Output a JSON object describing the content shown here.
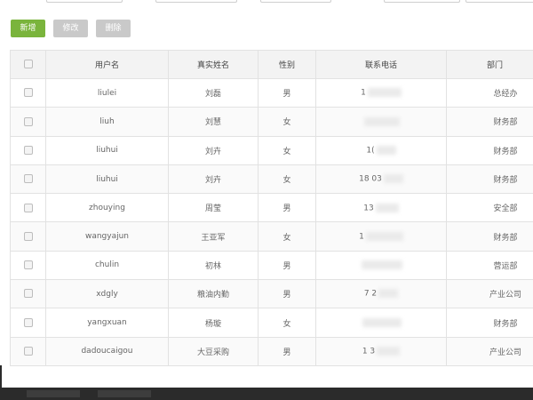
{
  "toolbar": {
    "add_label": "新增",
    "edit_label": "修改",
    "delete_label": "删除"
  },
  "colors": {
    "add_button": "#7ab43c",
    "disabled_button": "#c9c9c9"
  },
  "table": {
    "columns": [
      "",
      "用户名",
      "真实姓名",
      "性别",
      "联系电话",
      "部门"
    ],
    "rows": [
      {
        "username": "liulei",
        "realname": "刘磊",
        "gender": "男",
        "phone": "1",
        "dept": "总经办"
      },
      {
        "username": "liuh",
        "realname": "刘慧",
        "gender": "女",
        "phone": "",
        "dept": "财务部"
      },
      {
        "username": "liuhui",
        "realname": "刘卉",
        "gender": "女",
        "phone": "1(",
        "dept": "财务部"
      },
      {
        "username": "liuhui",
        "realname": "刘卉",
        "gender": "女",
        "phone": "18 03",
        "dept": "财务部"
      },
      {
        "username": "zhouying",
        "realname": "周莹",
        "gender": "男",
        "phone": "13",
        "dept": "安全部"
      },
      {
        "username": "wangyajun",
        "realname": "王亚军",
        "gender": "女",
        "phone": "1",
        "dept": "财务部"
      },
      {
        "username": "chulin",
        "realname": "初林",
        "gender": "男",
        "phone": "",
        "dept": "营运部"
      },
      {
        "username": "xdgly",
        "realname": "粮油内勤",
        "gender": "男",
        "phone": "7 2",
        "dept": "产业公司"
      },
      {
        "username": "yangxuan",
        "realname": "杨璇",
        "gender": "女",
        "phone": "",
        "dept": "财务部"
      },
      {
        "username": "dadoucaigou",
        "realname": "大豆采购",
        "gender": "男",
        "phone": "1 3",
        "dept": "产业公司"
      }
    ]
  }
}
